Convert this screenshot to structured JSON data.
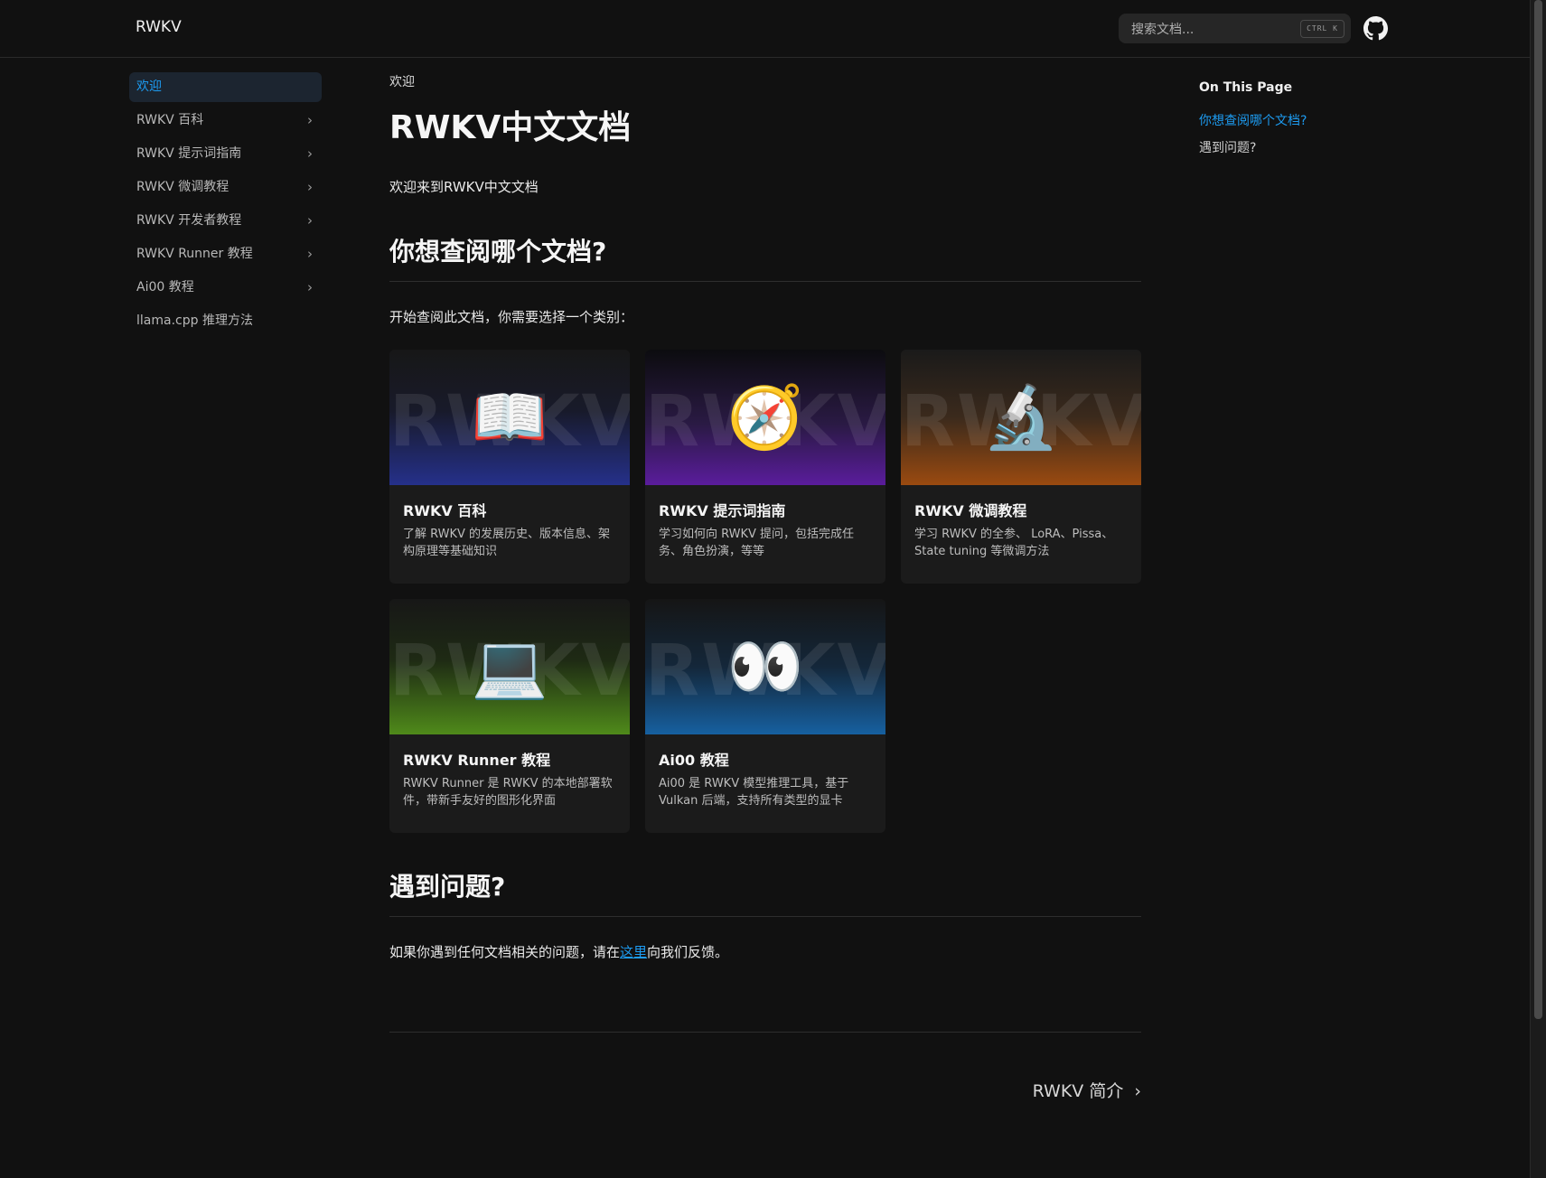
{
  "header": {
    "brand": "RWKV",
    "search_placeholder": "搜索文档...",
    "search_shortcut": "CTRL K",
    "github_icon": "github-icon"
  },
  "sidebar": {
    "items": [
      {
        "label": "欢迎",
        "active": true,
        "expandable": false
      },
      {
        "label": "RWKV 百科",
        "active": false,
        "expandable": true
      },
      {
        "label": "RWKV 提示词指南",
        "active": false,
        "expandable": true
      },
      {
        "label": "RWKV 微调教程",
        "active": false,
        "expandable": true
      },
      {
        "label": "RWKV 开发者教程",
        "active": false,
        "expandable": true
      },
      {
        "label": "RWKV Runner 教程",
        "active": false,
        "expandable": true
      },
      {
        "label": "Ai00 教程",
        "active": false,
        "expandable": true
      },
      {
        "label": "llama.cpp 推理方法",
        "active": false,
        "expandable": false
      }
    ],
    "chevron": "›"
  },
  "main": {
    "breadcrumb": "欢迎",
    "title": "RWKV中文文档",
    "intro": "欢迎来到RWKV中文文档",
    "section1_heading": "你想查阅哪个文档?",
    "section1_text": "开始查阅此文档，你需要选择一个类别：",
    "cards": [
      {
        "watermark": "RWKV",
        "emoji": "📖",
        "icon": "open-book-icon",
        "title": "RWKV 百科",
        "desc": "了解 RWKV 的发展历史、版本信息、架构原理等基础知识"
      },
      {
        "watermark": "RWKV",
        "emoji": "🧭",
        "icon": "compass-icon",
        "title": "RWKV 提示词指南",
        "desc": "学习如何向 RWKV 提问，包括完成任务、角色扮演，等等"
      },
      {
        "watermark": "RWKV",
        "emoji": "🔬",
        "icon": "microscope-icon",
        "title": "RWKV 微调教程",
        "desc": "学习 RWKV 的全参、 LoRA、Pissa、State tuning 等微调方法"
      },
      {
        "watermark": "RWKV",
        "emoji": "💻",
        "icon": "laptop-icon",
        "title": "RWKV Runner 教程",
        "desc": "RWKV Runner 是 RWKV 的本地部署软件，带新手友好的图形化界面"
      },
      {
        "watermark": "RWKV",
        "emoji": "👀",
        "icon": "eyes-icon",
        "title": "Ai00 教程",
        "desc": "Ai00 是 RWKV 模型推理工具，基于 Vulkan 后端，支持所有类型的显卡"
      }
    ],
    "section2_heading": "遇到问题?",
    "section2_before": "如果你遇到任何文档相关的问题，请在",
    "section2_link": "这里",
    "section2_after": "向我们反馈。",
    "next_label": "RWKV 简介",
    "next_chevron": "›"
  },
  "toc": {
    "title": "On This Page",
    "links": [
      {
        "label": "你想查阅哪个文档?",
        "active": true
      },
      {
        "label": "遇到问题?",
        "active": false
      }
    ]
  },
  "colors": {
    "background": "#111111",
    "accent": "#1d9bf0",
    "card_bg": "#1b1b1b"
  }
}
